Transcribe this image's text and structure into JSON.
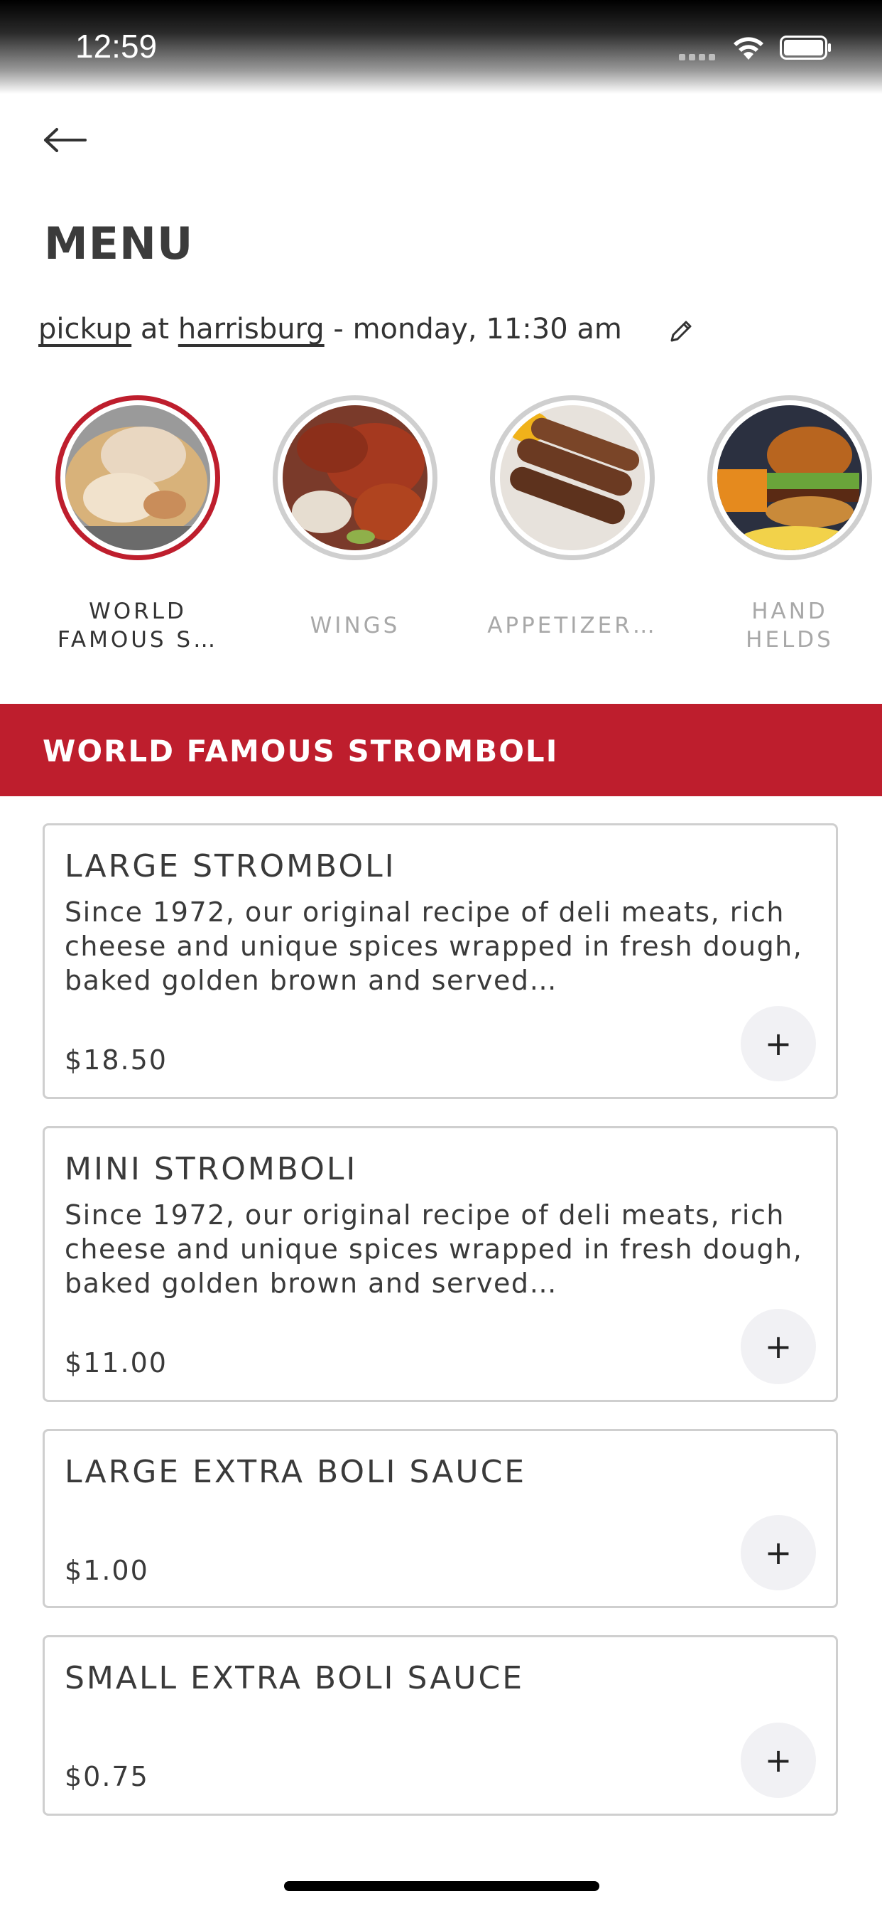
{
  "status_bar": {
    "time": "12:59"
  },
  "header": {
    "title": "MENU",
    "order_mode": "pickup",
    "at_text": "at",
    "location": "harrisburg",
    "schedule": "- monday, 11:30 am"
  },
  "categories": [
    {
      "label": "WORLD FAMOUS S…",
      "active": true
    },
    {
      "label": "WINGS",
      "active": false
    },
    {
      "label": "APPETIZER…",
      "active": false
    },
    {
      "label": "HAND HELDS",
      "active": false
    }
  ],
  "section": {
    "title": "WORLD FAMOUS STROMBOLI"
  },
  "items": [
    {
      "name": "LARGE STROMBOLI",
      "description": "Since 1972, our original recipe of deli meats, rich cheese and unique spices wrapped in fresh dough, baked golden brown and served…",
      "price": "$18.50",
      "add_label": "+"
    },
    {
      "name": "MINI STROMBOLI",
      "description": "Since 1972, our original recipe of deli meats, rich cheese and unique spices wrapped in fresh dough, baked golden brown and served…",
      "price": "$11.00",
      "add_label": "+"
    },
    {
      "name": "LARGE EXTRA BOLI SAUCE",
      "description": "",
      "price": "$1.00",
      "add_label": "+"
    },
    {
      "name": "SMALL EXTRA BOLI SAUCE",
      "description": "",
      "price": "$0.75",
      "add_label": "+"
    }
  ],
  "colors": {
    "accent": "#be1e2d",
    "ring_inactive": "#cfcfcf",
    "add_button_bg": "#f1f1f4"
  }
}
